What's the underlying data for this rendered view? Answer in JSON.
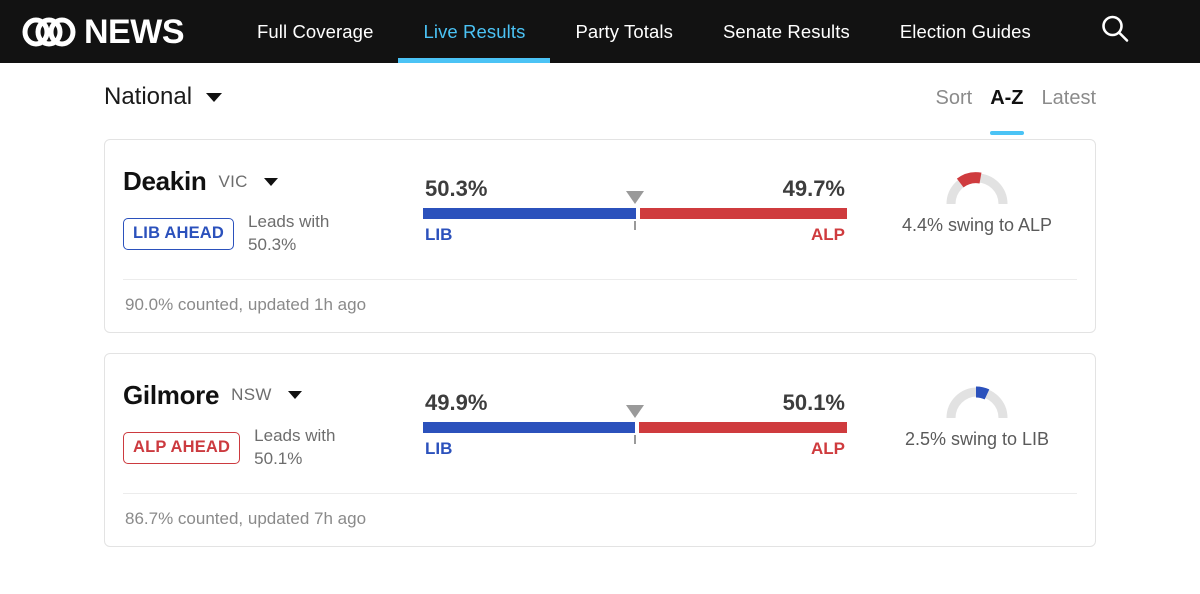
{
  "header": {
    "logo_icon": "abc-logo-icon",
    "brand_word": "NEWS",
    "nav": [
      {
        "label": "Full Coverage",
        "active": false
      },
      {
        "label": "Live Results",
        "active": true
      },
      {
        "label": "Party Totals",
        "active": false
      },
      {
        "label": "Senate Results",
        "active": false
      },
      {
        "label": "Election Guides",
        "active": false
      }
    ],
    "search_icon": "search-icon",
    "accent_color": "#4BC3F5",
    "background_color": "#121212"
  },
  "controls": {
    "region": "National",
    "region_caret_icon": "chevron-down-icon",
    "sort_label": "Sort",
    "sort_options": [
      {
        "label": "A-Z",
        "active": true
      },
      {
        "label": "Latest",
        "active": false
      }
    ]
  },
  "colors": {
    "lib": "#2B51BC",
    "alp": "#CF3B3E",
    "gauge_track": "#E2E2E2",
    "marker": "#9A9A9A"
  },
  "seats": [
    {
      "name": "Deakin",
      "state": "VIC",
      "caret_icon": "chevron-down-icon",
      "badge": "LIB AHEAD",
      "badge_party": "lib",
      "leads_line1": "Leads with",
      "leads_line2": "50.3%",
      "lib_pct_label": "50.3%",
      "alp_pct_label": "49.7%",
      "lib_pct": 50.3,
      "alp_pct": 49.7,
      "lib_label": "LIB",
      "alp_label": "ALP",
      "swing_text": "4.4% swing to ALP",
      "swing_pct": 4.4,
      "swing_party": "alp",
      "swing_color": "#CF3B3E",
      "footer": "90.0% counted, updated 1h ago",
      "counted_pct": "90.0%",
      "updated": "1h ago"
    },
    {
      "name": "Gilmore",
      "state": "NSW",
      "caret_icon": "chevron-down-icon",
      "badge": "ALP AHEAD",
      "badge_party": "alp",
      "leads_line1": "Leads with",
      "leads_line2": "50.1%",
      "lib_pct_label": "49.9%",
      "alp_pct_label": "50.1%",
      "lib_pct": 49.9,
      "alp_pct": 50.1,
      "lib_label": "LIB",
      "alp_label": "ALP",
      "swing_text": "2.5% swing to LIB",
      "swing_pct": 2.5,
      "swing_party": "lib",
      "swing_color": "#2B51BC",
      "footer": "86.7% counted, updated 7h ago",
      "counted_pct": "86.7%",
      "updated": "7h ago"
    }
  ]
}
